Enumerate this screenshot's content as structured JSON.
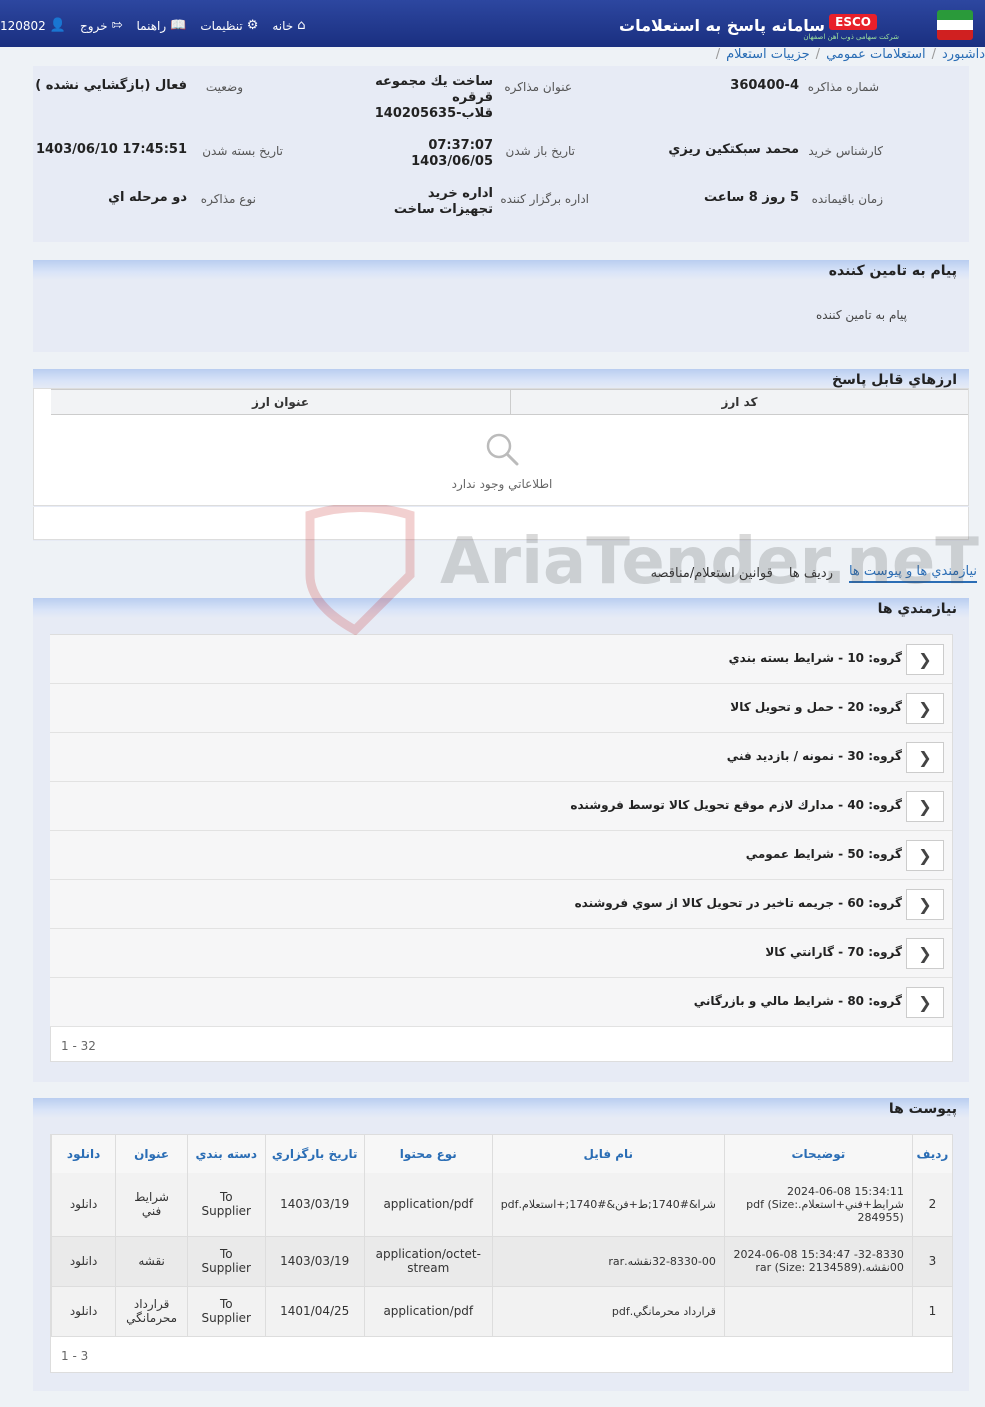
{
  "header": {
    "app_title": "سامانه پاسخ به استعلامات",
    "brand": "ESCO",
    "brand_sub": "شرکت سهامی ذوب آهن اصفهان",
    "nav": {
      "home": "خانه",
      "settings": "تنظيمات",
      "guide": "راهنما",
      "logout": "خروج",
      "user": "120802"
    }
  },
  "breadcrumb": [
    "داشبورد",
    "استعلامات عمومي",
    "جزييات استعلام"
  ],
  "info": {
    "tender_no_label": "شماره مذاكره",
    "tender_no": "360400-4",
    "title_label": "عنوان مذاكره",
    "title": "ساخت يك مجموعه قرقره قلاب-140205635",
    "status_label": "وضعيت",
    "status": "فعال (بازگشايي نشده )",
    "buyer_label": "كارشناس خريد",
    "buyer": "محمد سبكتكين ريزي",
    "open_date_label": "تاريخ باز شدن",
    "open_time": "07:37:07",
    "open_date": "1403/06/05",
    "close_date_label": "تاريخ بسته شدن",
    "close_date": "1403/06/10 17:45:51",
    "remaining_label": "زمان باقيمانده",
    "remaining": "5 روز 8 ساعت",
    "organizer_label": "اداره برگزار كننده",
    "organizer": "اداره خريد تجهيزات ساخت",
    "type_label": "نوع مذاكره",
    "type": "دو مرحله اي"
  },
  "supplier_msg": {
    "title": "پيام به تامين كننده",
    "text": "پيام به تامين كننده"
  },
  "currencies": {
    "title": "ارزهاي قابل پاسخ",
    "col_code": "كد ارز",
    "col_name": "عنوان ارز",
    "empty": "اطلاعاتي وجود ندارد"
  },
  "tabs": [
    "نيازمندي ها و پيوست ها",
    "رديف ها",
    "قوانين استعلام/مناقصه"
  ],
  "requirements": {
    "title": "نيازمندي ها",
    "groups": [
      "گروه: 10 - شرايط بسته بندي",
      "گروه: 20 - حمل و تحويل كالا",
      "گروه: 30 - نمونه / بازديد فني",
      "گروه: 40 - مدارك لازم موقع تحويل كالا توسط فروشنده",
      "گروه: 50 - شرايط عمومي",
      "گروه: 60 - جريمه تاخير در تحويل كالا از سوي فروشنده",
      "گروه: 70 - گارانتي كالا",
      "گروه: 80 - شرايط مالي و بازرگاني"
    ],
    "pager": "1 - 32"
  },
  "attachments": {
    "title": "پيوست ها",
    "columns": [
      "رديف",
      "توضيحات",
      "نام فايل",
      "نوع محتوا",
      "تاريخ بارگزاري",
      "دسته بندي",
      "عنوان",
      "دانلود"
    ],
    "rows": [
      [
        "2",
        "15:34:11 2024-06-08 شرايط+فني+استعلام.pdf (Size: 284955)",
        "شرا&#1740;ط+فن&#1740;+استعلام.pdf",
        "application/pdf",
        "1403/03/19",
        "To Supplier",
        "شرايط فني",
        "دانلود"
      ],
      [
        "3",
        "32-8330- 15:34:47 2024-06-08 00نقشه.rar (Size: 2134589)",
        "32-8330-00نقشه.rar",
        "application/octet-stream",
        "1403/03/19",
        "To Supplier",
        "نقشه",
        "دانلود"
      ],
      [
        "1",
        "",
        "قرارداد محرمانگي.pdf",
        "application/pdf",
        "1401/04/25",
        "To Supplier",
        "قرارداد محرمانگي",
        "دانلود"
      ]
    ],
    "pager": "1 - 3"
  },
  "watermark": "AriaTender.neT"
}
